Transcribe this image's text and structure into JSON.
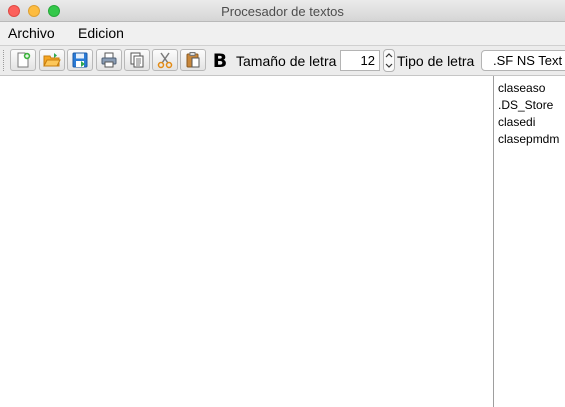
{
  "window": {
    "title": "Procesador de textos"
  },
  "menu": {
    "items": [
      "Archivo",
      "Edicion"
    ]
  },
  "toolbar": {
    "buttons": [
      {
        "name": "new-document-icon"
      },
      {
        "name": "open-folder-icon"
      },
      {
        "name": "save-icon"
      },
      {
        "name": "print-icon"
      },
      {
        "name": "copy-icon"
      },
      {
        "name": "cut-scissors-icon"
      },
      {
        "name": "paste-icon"
      }
    ],
    "bold_label": "B",
    "font_size_label": "Tamaño de letra",
    "font_size_value": "12",
    "font_type_label": "Tipo de letra",
    "font_type_value": ".SF NS Text"
  },
  "editor": {
    "content": ""
  },
  "files": [
    "claseaso",
    ".DS_Store",
    "clasedi",
    "clasepmdm"
  ],
  "colors": {
    "close": "#fc605b",
    "minimize": "#fdbc40",
    "maximize": "#34c84a",
    "toolbar_bg": "#ececec"
  }
}
